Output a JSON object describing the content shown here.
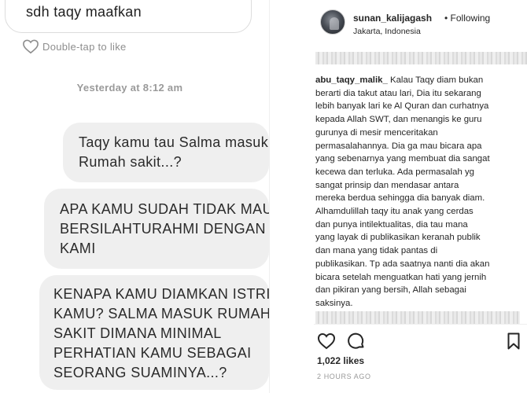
{
  "chat": {
    "top_message": "sdh taqy maafkan",
    "like_hint": "Double-tap to like",
    "timestamp": "Yesterday at 8:12 am",
    "messages": [
      {
        "lines": [
          "Taqy kamu tau Salma masuk",
          "Rumah sakit...?"
        ]
      },
      {
        "lines": [
          "APA KAMU SUDAH TIDAK MAU",
          "BERSILAHTURAHMI DENGAN",
          "KAMI"
        ]
      },
      {
        "lines": [
          "KENAPA KAMU DIAMKAN ISTRI",
          "KAMU? SALMA MASUK RUMAH",
          "SAKIT DIMANA MINIMAL",
          "PERHATIAN KAMU SEBAGAI",
          "SEORANG SUAMINYA...?"
        ]
      }
    ]
  },
  "post": {
    "username": "sunan_kalijagash",
    "following_label": "• Following",
    "location": "Jakarta, Indonesia",
    "caption_author": "abu_taqy_malik_",
    "caption_lines": [
      " Kalau Taqy diam bukan",
      "berarti dia takut atau lari, Dia itu sekarang",
      "lebih banyak lari ke Al Quran dan curhatnya",
      "kepada Allah SWT, dan menangis ke guru",
      "gurunya di mesir menceritakan",
      "permasalahannya. Dia ga mau bicara apa",
      "yang sebenarnya yang membuat dia sangat",
      "kecewa dan terluka. Ada permasalah yg",
      "sangat prinsip dan mendasar antara",
      "mereka berdua sehingga dia banyak diam.",
      "Alhamdulillah taqy itu anak yang cerdas",
      "dan punya intilektualitas, dia tau mana",
      "yang layak di publikasikan keranah publik",
      "dan mana yang tidak pantas di",
      "publikasikan. Tp ada saatnya nanti dia akan",
      "bicara setelah menguatkan hati yang jernih",
      "dan pikiran yang bersih, Allah sebagai",
      "saksinya."
    ],
    "likes": "1,022 likes",
    "time_ago": "2 HOURS AGO"
  },
  "icons": {
    "like": "heart-outline-icon",
    "comment": "comment-bubble-icon",
    "save": "bookmark-icon",
    "chat_like": "heart-outline-icon"
  }
}
